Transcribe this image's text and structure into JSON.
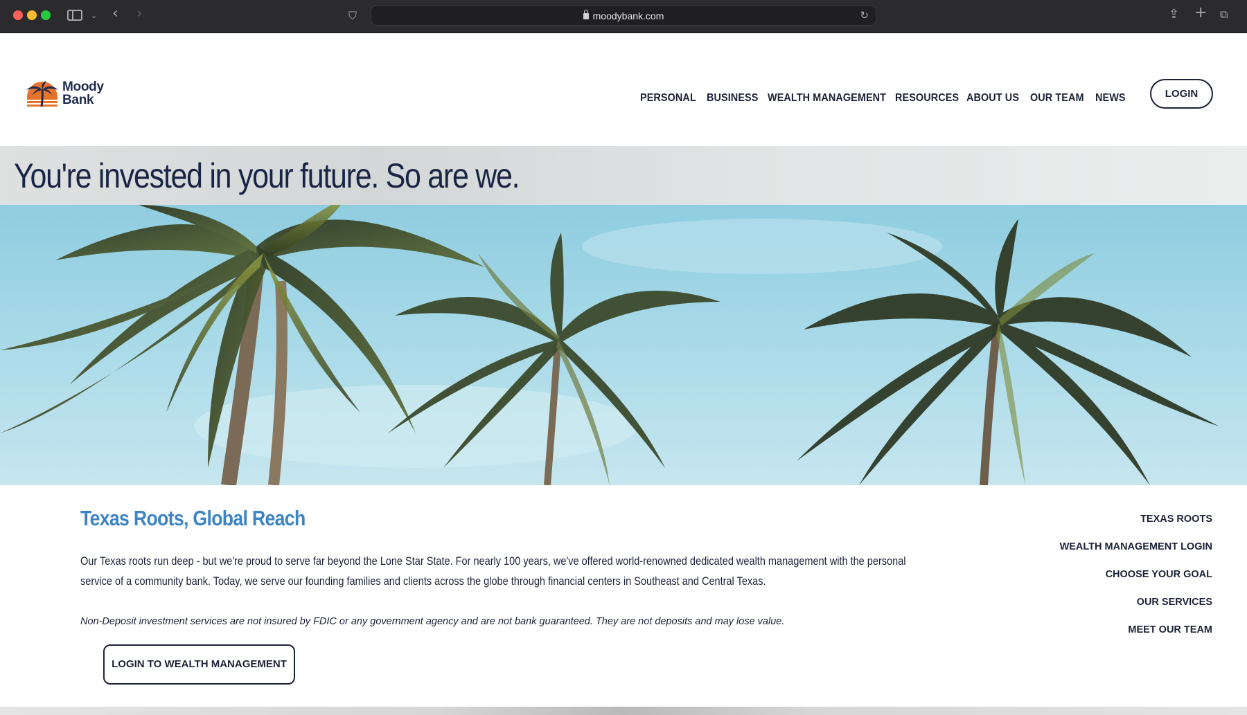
{
  "browser": {
    "url": "moodybank.com"
  },
  "logo": {
    "line1": "Moody",
    "line2": "Bank"
  },
  "nav": {
    "items": [
      {
        "label": "PERSONAL"
      },
      {
        "label": "BUSINESS"
      },
      {
        "label": "WEALTH MANAGEMENT"
      },
      {
        "label": "RESOURCES"
      },
      {
        "label": "ABOUT US"
      },
      {
        "label": "OUR TEAM"
      },
      {
        "label": "NEWS"
      }
    ],
    "login_label": "LOGIN"
  },
  "hero": {
    "title": "You're invested in your future. So are we."
  },
  "section": {
    "title": "Texas Roots, Global Reach",
    "body": "Our Texas roots run deep - but we're proud to serve far beyond the Lone Star State. For nearly 100 years, we've offered world-renowned dedicated wealth management with the personal service of a community bank. Today, we serve our founding families and clients across the globe through financial centers in Southeast and Central Texas.",
    "disclaimer": "Non-Deposit investment services are not insured by FDIC or any government agency and are not bank guaranteed. They are not deposits and may lose value.",
    "button_label": "LOGIN TO WEALTH MANAGEMENT"
  },
  "side_links": [
    {
      "label": "TEXAS ROOTS"
    },
    {
      "label": "WEALTH MANAGEMENT LOGIN"
    },
    {
      "label": "CHOOSE YOUR GOAL"
    },
    {
      "label": "OUR SERVICES"
    },
    {
      "label": "MEET OUR TEAM"
    }
  ],
  "colors": {
    "accent": "#3d84c4",
    "navy": "#1b2236",
    "logo_orange": "#e8742c"
  }
}
